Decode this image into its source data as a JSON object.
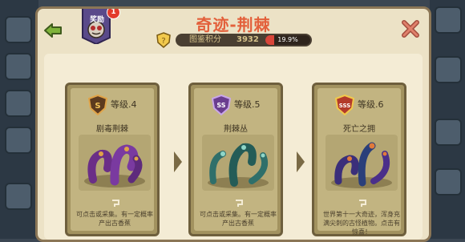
{
  "title": "奇迹-荆棘",
  "badge": {
    "label": "奖励",
    "count": "1"
  },
  "score": {
    "label": "图鉴积分",
    "value": "3932",
    "progress_text": "19.9%",
    "progress": 0.2
  },
  "cards": [
    {
      "level": "等级.4",
      "rank": "S",
      "name": "剧毒荆棘",
      "desc": "可点击或采集。有一定概率产出古香蕉"
    },
    {
      "level": "等级.5",
      "rank": "SS",
      "name": "荆棘丛",
      "desc": "可点击或采集。有一定概率产出古香蕉"
    },
    {
      "level": "等级.6",
      "rank": "SSS",
      "name": "死亡之拥",
      "desc": "世界第十一大奇迹，浑身充满尖刺的古怪植物。点击有惊喜！"
    }
  ],
  "colors": {
    "title": "#e3603b",
    "panel": "#ece2c6",
    "card": "#a2925f"
  },
  "icons": {
    "back": "back-arrow-icon",
    "close": "close-x-icon",
    "score": "score-shield-icon"
  }
}
